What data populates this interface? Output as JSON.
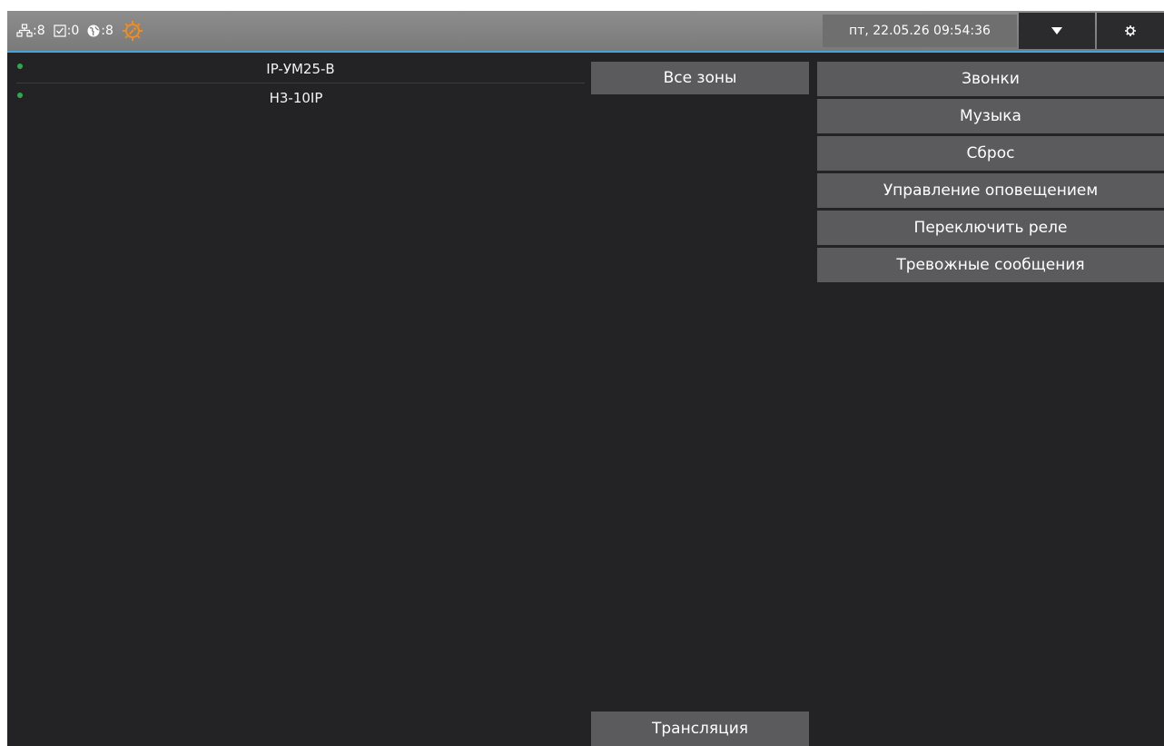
{
  "topbar": {
    "network_count": ":8",
    "check_count": ":0",
    "globe_count": ":8",
    "datetime": "пт, 22.05.26 09:54:36",
    "accent_color": "#f28c1a",
    "line_color": "#4aa3d8",
    "icons": {
      "network": "network-icon",
      "check": "checkbox-icon",
      "globe": "globe-icon",
      "service": "service-gear-icon",
      "dropdown": "chevron-down-icon",
      "settings": "gear-icon"
    }
  },
  "devices": [
    {
      "name": "IP-УМ25-В",
      "status": "online",
      "status_color": "#2ea84a"
    },
    {
      "name": "Н3-10IP",
      "status": "online",
      "status_color": "#2ea84a"
    }
  ],
  "zones": {
    "all_zones": "Все зоны",
    "broadcast": "Трансляция"
  },
  "actions": [
    "Звонки",
    "Музыка",
    "Сброс",
    "Управление оповещением",
    "Переключить реле",
    "Тревожные сообщения"
  ]
}
